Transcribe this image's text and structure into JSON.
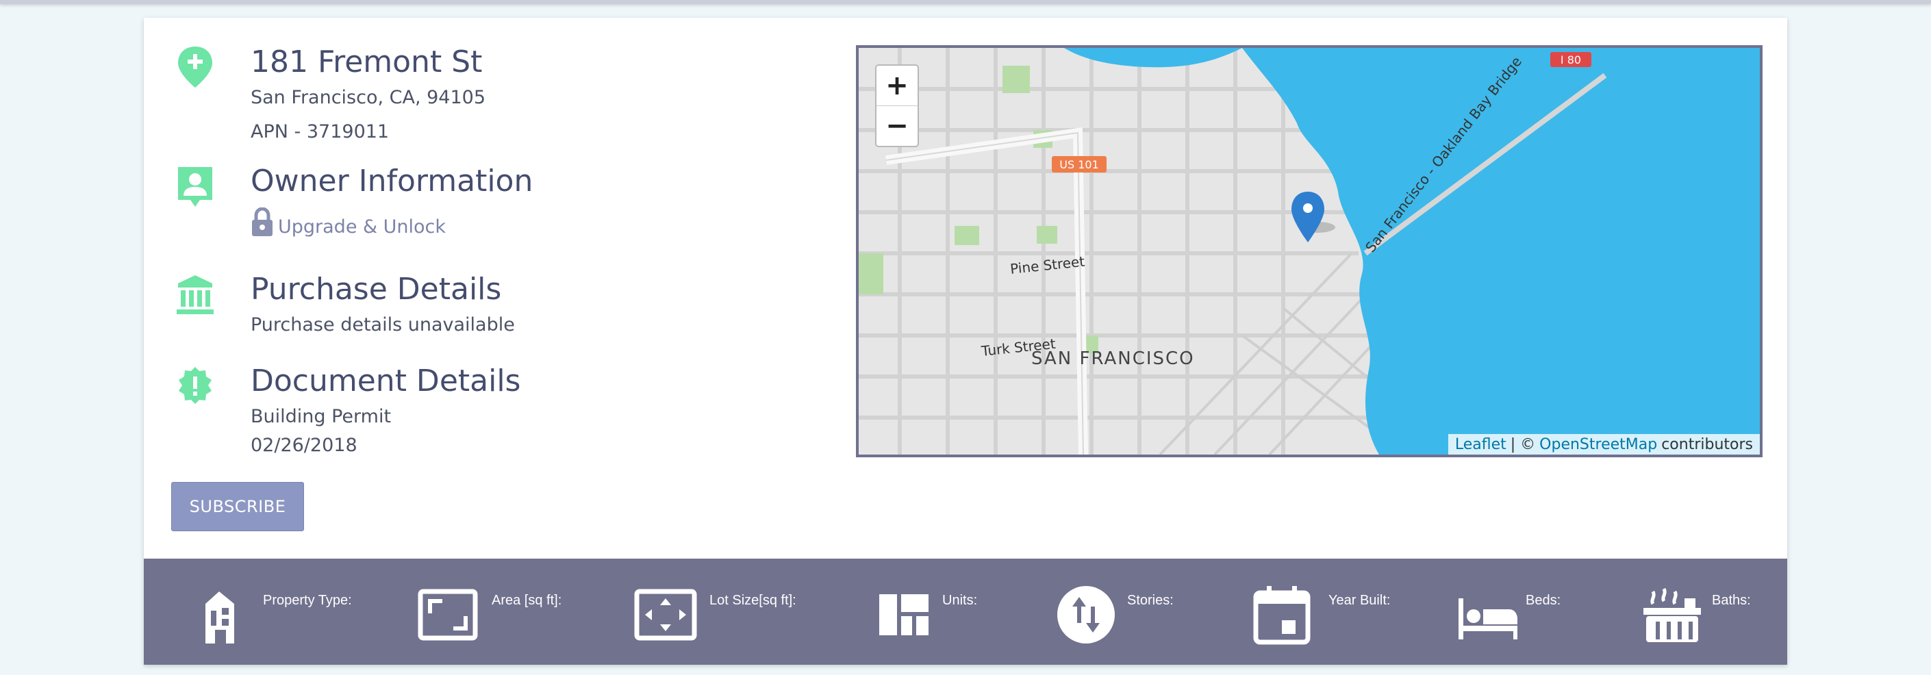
{
  "property": {
    "address": "181 Fremont St",
    "city_line": "San Francisco, CA, 94105",
    "apn": "APN - 3719011"
  },
  "owner": {
    "title": "Owner Information",
    "unlock_label": "Upgrade & Unlock"
  },
  "purchase": {
    "title": "Purchase Details",
    "text": "Purchase details unavailable"
  },
  "document": {
    "title": "Document Details",
    "type": "Building Permit",
    "date": "02/26/2018"
  },
  "subscribe_label": "SUBSCRIBE",
  "map": {
    "zoom_in": "+",
    "zoom_out": "−",
    "labels": {
      "highway_us101": "US 101",
      "highway_i80": "I 80",
      "bridge": "San Francisco - Oakland Bay Bridge",
      "pine": "Pine Street",
      "turk": "Turk Street",
      "city": "SAN FRANCISCO"
    },
    "attribution": {
      "leaflet": "Leaflet",
      "separator": "| ©",
      "osm": "OpenStreetMap",
      "contributors": "contributors"
    }
  },
  "features": [
    {
      "icon": "building-icon",
      "label": "Property Type:"
    },
    {
      "icon": "area-icon",
      "label": "Area [sq ft]:"
    },
    {
      "icon": "lot-size-icon",
      "label": "Lot Size[sq ft]:"
    },
    {
      "icon": "units-icon",
      "label": "Units:"
    },
    {
      "icon": "stories-icon",
      "label": "Stories:"
    },
    {
      "icon": "calendar-icon",
      "label": "Year Built:"
    },
    {
      "icon": "bed-icon",
      "label": "Beds:"
    },
    {
      "icon": "bath-icon",
      "label": "Baths:"
    }
  ],
  "colors": {
    "accent_green": "#6ee4a5",
    "heading": "#454d6e",
    "strip": "#70728e",
    "button": "#8d97c3",
    "water": "#3db8ea",
    "marker": "#2f7fd0"
  }
}
